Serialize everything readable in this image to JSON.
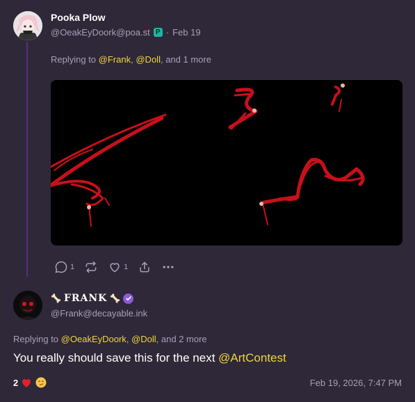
{
  "post1": {
    "display_name": "Pooka Plow",
    "handle": "@OeakEyDoork@poa.st",
    "separator": "·",
    "date": "Feb 19",
    "replying_prefix": "Replying to",
    "mentions": [
      "@Frank",
      "@Doll"
    ],
    "replying_suffix": "and 1 more",
    "comma": ",",
    "actions": {
      "reply_count": "1",
      "like_count": "1"
    }
  },
  "post2": {
    "display_name": "FRANK",
    "handle": "@Frank@decayable.ink",
    "replying_prefix": "Replying to",
    "mentions": [
      "@OeakEyDoork",
      "@Doll"
    ],
    "replying_suffix": "and 2 more",
    "comma": ",",
    "body_text": "You really should save this for the next",
    "body_mention": "@ArtContest",
    "reaction_count": "2",
    "timestamp": "Feb 19, 2026, 7:47 PM"
  },
  "icons": [
    "reply-icon",
    "boost-icon",
    "like-icon",
    "share-icon",
    "more-icon",
    "verified-icon",
    "heart-icon",
    "smirk-icon"
  ],
  "colors": {
    "background": "#2e2838",
    "mention": "#f0d53c",
    "muted": "#a8a0b8",
    "thread_line": "#5a2f7a",
    "verified": "#8c5bd6"
  }
}
